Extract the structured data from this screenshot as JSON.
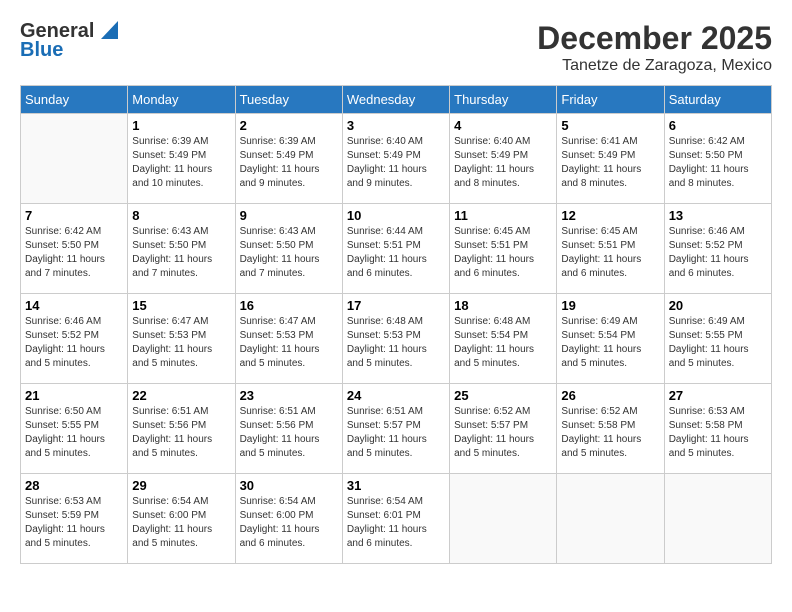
{
  "header": {
    "logo": {
      "general": "General",
      "blue": "Blue"
    },
    "title": "December 2025",
    "location": "Tanetze de Zaragoza, Mexico"
  },
  "calendar": {
    "days_of_week": [
      "Sunday",
      "Monday",
      "Tuesday",
      "Wednesday",
      "Thursday",
      "Friday",
      "Saturday"
    ],
    "weeks": [
      [
        {
          "day": "",
          "info": ""
        },
        {
          "day": "1",
          "info": "Sunrise: 6:39 AM\nSunset: 5:49 PM\nDaylight: 11 hours\nand 10 minutes."
        },
        {
          "day": "2",
          "info": "Sunrise: 6:39 AM\nSunset: 5:49 PM\nDaylight: 11 hours\nand 9 minutes."
        },
        {
          "day": "3",
          "info": "Sunrise: 6:40 AM\nSunset: 5:49 PM\nDaylight: 11 hours\nand 9 minutes."
        },
        {
          "day": "4",
          "info": "Sunrise: 6:40 AM\nSunset: 5:49 PM\nDaylight: 11 hours\nand 8 minutes."
        },
        {
          "day": "5",
          "info": "Sunrise: 6:41 AM\nSunset: 5:49 PM\nDaylight: 11 hours\nand 8 minutes."
        },
        {
          "day": "6",
          "info": "Sunrise: 6:42 AM\nSunset: 5:50 PM\nDaylight: 11 hours\nand 8 minutes."
        }
      ],
      [
        {
          "day": "7",
          "info": "Sunrise: 6:42 AM\nSunset: 5:50 PM\nDaylight: 11 hours\nand 7 minutes."
        },
        {
          "day": "8",
          "info": "Sunrise: 6:43 AM\nSunset: 5:50 PM\nDaylight: 11 hours\nand 7 minutes."
        },
        {
          "day": "9",
          "info": "Sunrise: 6:43 AM\nSunset: 5:50 PM\nDaylight: 11 hours\nand 7 minutes."
        },
        {
          "day": "10",
          "info": "Sunrise: 6:44 AM\nSunset: 5:51 PM\nDaylight: 11 hours\nand 6 minutes."
        },
        {
          "day": "11",
          "info": "Sunrise: 6:45 AM\nSunset: 5:51 PM\nDaylight: 11 hours\nand 6 minutes."
        },
        {
          "day": "12",
          "info": "Sunrise: 6:45 AM\nSunset: 5:51 PM\nDaylight: 11 hours\nand 6 minutes."
        },
        {
          "day": "13",
          "info": "Sunrise: 6:46 AM\nSunset: 5:52 PM\nDaylight: 11 hours\nand 6 minutes."
        }
      ],
      [
        {
          "day": "14",
          "info": "Sunrise: 6:46 AM\nSunset: 5:52 PM\nDaylight: 11 hours\nand 5 minutes."
        },
        {
          "day": "15",
          "info": "Sunrise: 6:47 AM\nSunset: 5:53 PM\nDaylight: 11 hours\nand 5 minutes."
        },
        {
          "day": "16",
          "info": "Sunrise: 6:47 AM\nSunset: 5:53 PM\nDaylight: 11 hours\nand 5 minutes."
        },
        {
          "day": "17",
          "info": "Sunrise: 6:48 AM\nSunset: 5:53 PM\nDaylight: 11 hours\nand 5 minutes."
        },
        {
          "day": "18",
          "info": "Sunrise: 6:48 AM\nSunset: 5:54 PM\nDaylight: 11 hours\nand 5 minutes."
        },
        {
          "day": "19",
          "info": "Sunrise: 6:49 AM\nSunset: 5:54 PM\nDaylight: 11 hours\nand 5 minutes."
        },
        {
          "day": "20",
          "info": "Sunrise: 6:49 AM\nSunset: 5:55 PM\nDaylight: 11 hours\nand 5 minutes."
        }
      ],
      [
        {
          "day": "21",
          "info": "Sunrise: 6:50 AM\nSunset: 5:55 PM\nDaylight: 11 hours\nand 5 minutes."
        },
        {
          "day": "22",
          "info": "Sunrise: 6:51 AM\nSunset: 5:56 PM\nDaylight: 11 hours\nand 5 minutes."
        },
        {
          "day": "23",
          "info": "Sunrise: 6:51 AM\nSunset: 5:56 PM\nDaylight: 11 hours\nand 5 minutes."
        },
        {
          "day": "24",
          "info": "Sunrise: 6:51 AM\nSunset: 5:57 PM\nDaylight: 11 hours\nand 5 minutes."
        },
        {
          "day": "25",
          "info": "Sunrise: 6:52 AM\nSunset: 5:57 PM\nDaylight: 11 hours\nand 5 minutes."
        },
        {
          "day": "26",
          "info": "Sunrise: 6:52 AM\nSunset: 5:58 PM\nDaylight: 11 hours\nand 5 minutes."
        },
        {
          "day": "27",
          "info": "Sunrise: 6:53 AM\nSunset: 5:58 PM\nDaylight: 11 hours\nand 5 minutes."
        }
      ],
      [
        {
          "day": "28",
          "info": "Sunrise: 6:53 AM\nSunset: 5:59 PM\nDaylight: 11 hours\nand 5 minutes."
        },
        {
          "day": "29",
          "info": "Sunrise: 6:54 AM\nSunset: 6:00 PM\nDaylight: 11 hours\nand 5 minutes."
        },
        {
          "day": "30",
          "info": "Sunrise: 6:54 AM\nSunset: 6:00 PM\nDaylight: 11 hours\nand 6 minutes."
        },
        {
          "day": "31",
          "info": "Sunrise: 6:54 AM\nSunset: 6:01 PM\nDaylight: 11 hours\nand 6 minutes."
        },
        {
          "day": "",
          "info": ""
        },
        {
          "day": "",
          "info": ""
        },
        {
          "day": "",
          "info": ""
        }
      ]
    ]
  }
}
